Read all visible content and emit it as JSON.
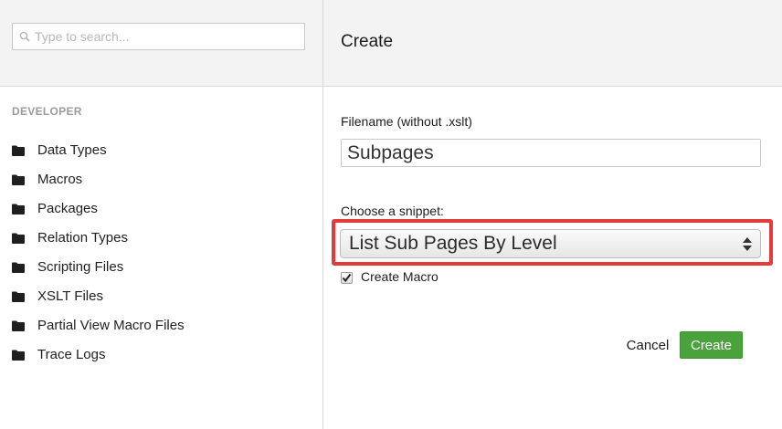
{
  "sidebar": {
    "search_placeholder": "Type to search...",
    "section_title": "DEVELOPER",
    "items": [
      {
        "label": "Data Types",
        "icon": "folder-icon"
      },
      {
        "label": "Macros",
        "icon": "folder-icon"
      },
      {
        "label": "Packages",
        "icon": "folder-icon"
      },
      {
        "label": "Relation Types",
        "icon": "folder-icon"
      },
      {
        "label": "Scripting Files",
        "icon": "folder-icon"
      },
      {
        "label": "XSLT Files",
        "icon": "folder-icon"
      },
      {
        "label": "Partial View Macro Files",
        "icon": "folder-icon"
      },
      {
        "label": "Trace Logs",
        "icon": "folder-icon"
      }
    ]
  },
  "dialog": {
    "title": "Create",
    "filename_label": "Filename (without .xslt)",
    "filename_value": "Subpages",
    "snippet_label": "Choose a snippet:",
    "snippet_selected": "List Sub Pages By Level",
    "create_macro_label": "Create Macro",
    "create_macro_checked": true,
    "cancel_label": "Cancel",
    "create_label": "Create"
  },
  "colors": {
    "accent_green": "#4aa23c",
    "highlight_red": "#e23b3b",
    "header_bg": "#f3f3f3"
  }
}
